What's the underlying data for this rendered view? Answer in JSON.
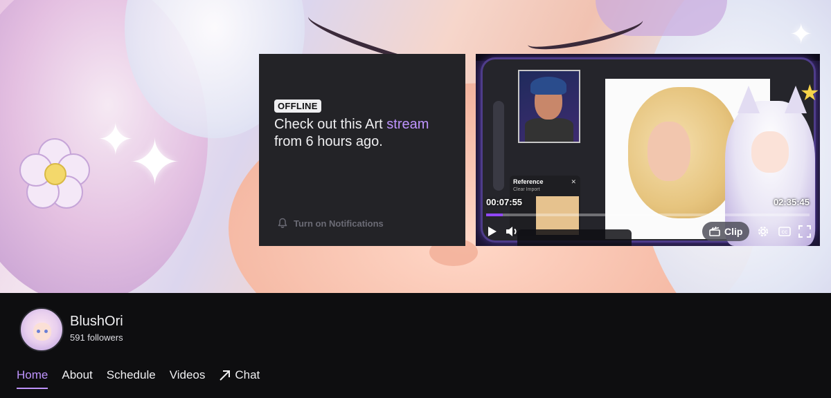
{
  "offline_card": {
    "badge": "OFFLINE",
    "text_before": "Check out this Art ",
    "link": "stream",
    "text_after": " from 6 hours ago.",
    "notifications_label": "Turn on Notifications"
  },
  "player": {
    "current_time": "00:07:55",
    "duration": "02:35:45",
    "progress_fraction": 0.051,
    "clip_label": "Clip",
    "reference_panel": {
      "title": "Reference",
      "actions": "Clear   Import"
    }
  },
  "channel": {
    "name": "BlushOri",
    "followers": "591 followers"
  },
  "tabs": [
    {
      "label": "Home",
      "active": true
    },
    {
      "label": "About",
      "active": false
    },
    {
      "label": "Schedule",
      "active": false
    },
    {
      "label": "Videos",
      "active": false
    },
    {
      "label": "Chat",
      "active": false,
      "icon": "external-arrow-icon"
    }
  ],
  "colors": {
    "accent": "#bf94ff",
    "progress": "#9147ff",
    "background": "#0e0e10",
    "card": "#232327"
  }
}
